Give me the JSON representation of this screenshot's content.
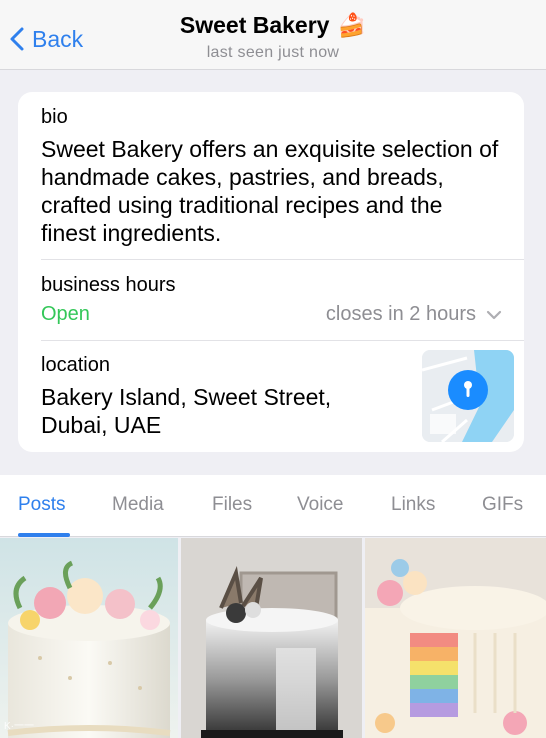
{
  "header": {
    "back_label": "Back",
    "title": "Sweet Bakery",
    "title_emoji": "🍰",
    "subtitle": "last seen just now"
  },
  "info": {
    "bio_label": "bio",
    "bio_text": "Sweet Bakery offers an exquisite selection of handmade cakes, pastries, and breads, crafted using traditional recipes and the finest ingredients.",
    "hours_label": "business hours",
    "hours_status": "Open",
    "hours_closing": "closes in 2 hours",
    "location_label": "location",
    "location_text": "Bakery Island, Sweet Street, Dubai, UAE"
  },
  "tabs": [
    "Posts",
    "Media",
    "Files",
    "Voice",
    "Links",
    "GIFs"
  ],
  "active_tab": "Posts",
  "media": [
    {
      "icon": "floral-cake-image"
    },
    {
      "icon": "modern-cake-image"
    },
    {
      "icon": "rainbow-cake-image"
    }
  ],
  "watermark": "K·一一",
  "colors": {
    "accent": "#2f80ed",
    "open": "#34c759",
    "secondary": "#8e8e93"
  }
}
